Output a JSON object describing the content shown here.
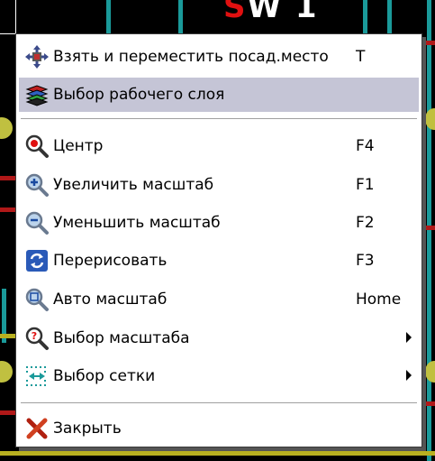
{
  "background": {
    "ref_text_left": "W",
    "ref_text_right": "1",
    "ref_marker": "S"
  },
  "menu": {
    "items": [
      {
        "label": "Взять и переместить посад.место",
        "shortcut": "T",
        "icon": "move-footprint-icon",
        "highlighted": false
      },
      {
        "label": "Выбор рабочего слоя",
        "shortcut": "",
        "icon": "layers-icon",
        "highlighted": true
      },
      {
        "label": "Центр",
        "shortcut": "F4",
        "icon": "zoom-center-icon",
        "highlighted": false
      },
      {
        "label": "Увеличить масштаб",
        "shortcut": "F1",
        "icon": "zoom-in-icon",
        "highlighted": false
      },
      {
        "label": "Уменьшить масштаб",
        "shortcut": "F2",
        "icon": "zoom-out-icon",
        "highlighted": false
      },
      {
        "label": "Перерисовать",
        "shortcut": "F3",
        "icon": "redraw-icon",
        "highlighted": false
      },
      {
        "label": "Авто масштаб",
        "shortcut": "Home",
        "icon": "zoom-auto-icon",
        "highlighted": false
      },
      {
        "label": "Выбор масштаба",
        "shortcut": "",
        "icon": "zoom-select-icon",
        "highlighted": false,
        "submenu": true
      },
      {
        "label": "Выбор сетки",
        "shortcut": "",
        "icon": "grid-select-icon",
        "highlighted": false,
        "submenu": true
      },
      {
        "label": "Закрыть",
        "shortcut": "",
        "icon": "close-icon",
        "highlighted": false
      }
    ]
  },
  "colors": {
    "highlight": "#c5c5d6",
    "trace_cyan": "#1a9a9a",
    "trace_red": "#b01818",
    "pad_yellow": "#c0c040"
  }
}
